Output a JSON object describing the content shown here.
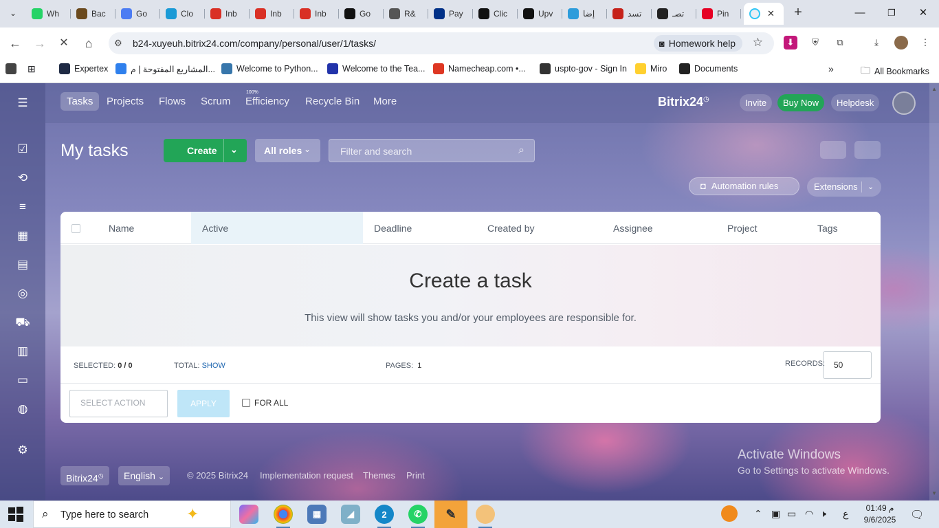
{
  "browser": {
    "tabs": [
      {
        "title": "Wh",
        "icon": "whatsapp-icon",
        "color": "#25d366"
      },
      {
        "title": "Bac",
        "icon": "app-icon",
        "color": "#6b4a1e"
      },
      {
        "title": "Go",
        "icon": "gemini-icon",
        "color": "#4c7cf3"
      },
      {
        "title": "Clo",
        "icon": "c-icon",
        "color": "#1a9ad6"
      },
      {
        "title": "Inb",
        "icon": "gmail-icon",
        "color": "#d93025"
      },
      {
        "title": "Inb",
        "icon": "gmail-icon",
        "color": "#d93025"
      },
      {
        "title": "Inb",
        "icon": "gmail-icon",
        "color": "#d93025"
      },
      {
        "title": "Go",
        "icon": "github-icon",
        "color": "#111111"
      },
      {
        "title": "R&",
        "icon": "folder-icon",
        "color": "#555555"
      },
      {
        "title": "Pay",
        "icon": "paypal-icon",
        "color": "#003087"
      },
      {
        "title": "Clic",
        "icon": "upwork-icon",
        "color": "#111111"
      },
      {
        "title": "Upv",
        "icon": "upwork-icon",
        "color": "#111111"
      },
      {
        "title": "إضا",
        "icon": "circle-icon",
        "color": "#2d9cdb"
      },
      {
        "title": "تسد",
        "icon": "pdf-icon",
        "color": "#c6221a"
      },
      {
        "title": "تصـ",
        "icon": "openai-icon",
        "color": "#222222"
      },
      {
        "title": "Pin",
        "icon": "pinterest-icon",
        "color": "#e60023"
      }
    ],
    "url": "b24-xuyeuh.bitrix24.com/company/personal/user/1/tasks/",
    "homework_help": "Homework help",
    "bookmarks": [
      {
        "label": "Expertex",
        "color": "#1f2a44"
      },
      {
        "label": "المشاريع المفتوحة | م...",
        "color": "#2f80ed"
      },
      {
        "label": "Welcome to Python...",
        "color": "#3776ab"
      },
      {
        "label": "Welcome to the Tea...",
        "color": "#2233aa"
      },
      {
        "label": "Namecheap.com •...",
        "color": "#de3723"
      },
      {
        "label": "uspto-gov - Sign In",
        "color": "#333333"
      },
      {
        "label": "Miro",
        "color": "#ffd02f"
      },
      {
        "label": "Documents",
        "color": "#222222"
      }
    ],
    "all_bookmarks": "All Bookmarks"
  },
  "nav": {
    "tasks": "Tasks",
    "projects": "Projects",
    "flows": "Flows",
    "scrum": "Scrum",
    "efficiency": "Efficiency",
    "efficiency_value": "100%",
    "recycle_bin": "Recycle Bin",
    "more": "More",
    "brand": "Bitrix",
    "brand_num": "24",
    "invite": "Invite",
    "buy_now": "Buy Now",
    "helpdesk": "Helpdesk"
  },
  "toolbar": {
    "title": "My tasks",
    "create": "Create",
    "all_roles": "All roles",
    "search_placeholder": "Filter and search",
    "automation_rules": "Automation rules",
    "extensions": "Extensions"
  },
  "grid": {
    "columns": [
      "Name",
      "Active",
      "Deadline",
      "Created by",
      "Assignee",
      "Project",
      "Tags"
    ],
    "empty_title": "Create a task",
    "empty_subtitle": "This view will show tasks you and/or your employees are responsible for.",
    "selected_label": "SELECTED:",
    "selected_value": "0 / 0",
    "total_label": "TOTAL:",
    "total_link": "SHOW",
    "pages_label": "PAGES:",
    "pages_value": "1",
    "records_label": "RECORDS:",
    "records_value": "50",
    "select_action": "SELECT ACTION",
    "apply": "APPLY",
    "for_all": "FOR ALL"
  },
  "footer": {
    "brand": "Bitrix24",
    "language": "English",
    "copyright": "© 2025 Bitrix24",
    "implementation_request": "Implementation request",
    "themes": "Themes",
    "print": "Print"
  },
  "watermark": {
    "title": "Activate Windows",
    "subtitle": "Go to Settings to activate Windows."
  },
  "taskbar": {
    "search_placeholder": "Type here to search",
    "time": "01:49 م",
    "date": "9/6/2025",
    "lang": "ع",
    "whatsapp_badge": "2"
  }
}
